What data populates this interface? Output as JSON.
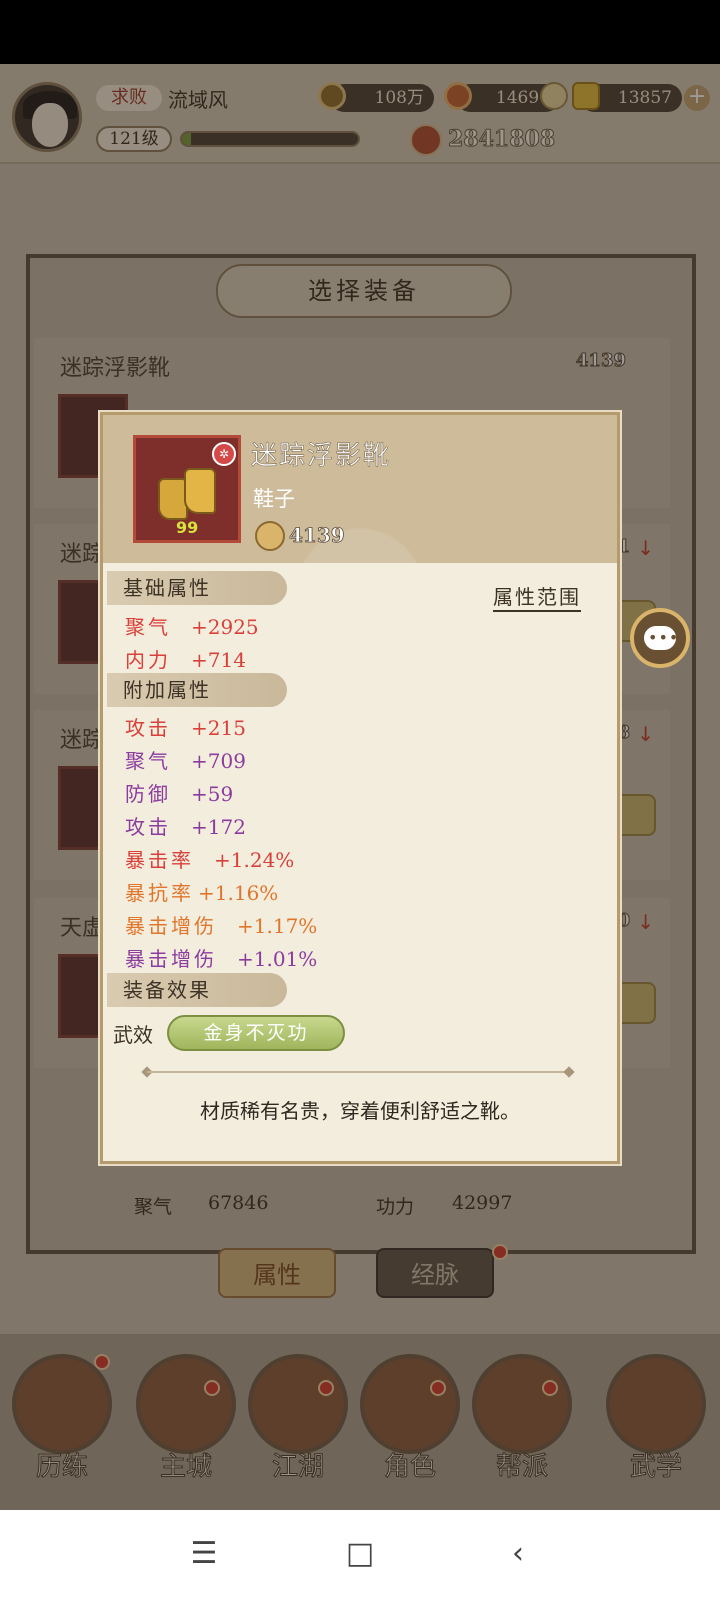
{
  "header": {
    "rank_tag": "求败",
    "player_name": "流域风",
    "level": "121级",
    "exp_fraction": 0.05,
    "currency_coins": "108万",
    "currency_ingots": "14690",
    "currency_gold": "13857",
    "combat_power": "2841808"
  },
  "background_panel": {
    "title": "选择装备",
    "cards": [
      {
        "name": "迷踪浮影靴",
        "power": "4139"
      },
      {
        "name": "迷踪",
        "power": "71"
      },
      {
        "name": "迷踪",
        "power": "68"
      },
      {
        "name": "天虚",
        "power": "40"
      }
    ],
    "stats": {
      "label_a": "聚气",
      "value_a": "67846",
      "label_b": "功力",
      "value_b": "42997"
    }
  },
  "item": {
    "name": "迷踪浮影靴",
    "type": "鞋子",
    "power": "4139",
    "level": "99",
    "badge_icon": "snowflake-icon"
  },
  "popup": {
    "base_header": "基础属性",
    "range_link": "属性范围",
    "base_stats": [
      {
        "name": "聚气",
        "value": "+2925"
      },
      {
        "name": "内力",
        "value": "+714"
      }
    ],
    "extra_header": "附加属性",
    "extra_stats": [
      {
        "name": "攻击",
        "value": "+215"
      },
      {
        "name": "聚气",
        "value": "+709"
      },
      {
        "name": "防御",
        "value": "+59"
      },
      {
        "name": "攻击",
        "value": "+172"
      },
      {
        "name": "暴击率",
        "value": "+1.24%"
      },
      {
        "name": "暴抗率",
        "value": "+1.16%"
      },
      {
        "name": "暴击增伤",
        "value": "+1.17%"
      },
      {
        "name": "暴击增伤",
        "value": "+1.01%"
      }
    ],
    "effect_header": "装备效果",
    "effect_label": "武效",
    "effect_name": "金身不灭功",
    "description": "材质稀有名贵，穿着便利舒适之靴。"
  },
  "tabs": {
    "attributes": "属性",
    "meridians": "经脉"
  },
  "bottom_nav": [
    "历练",
    "主城",
    "江湖",
    "角色",
    "帮派",
    "武学"
  ],
  "colors": {
    "stat_red": "#d9403a",
    "stat_purple": "#8c3c9e",
    "stat_orange": "#e0762c",
    "effect_green": "#9fb55c"
  }
}
